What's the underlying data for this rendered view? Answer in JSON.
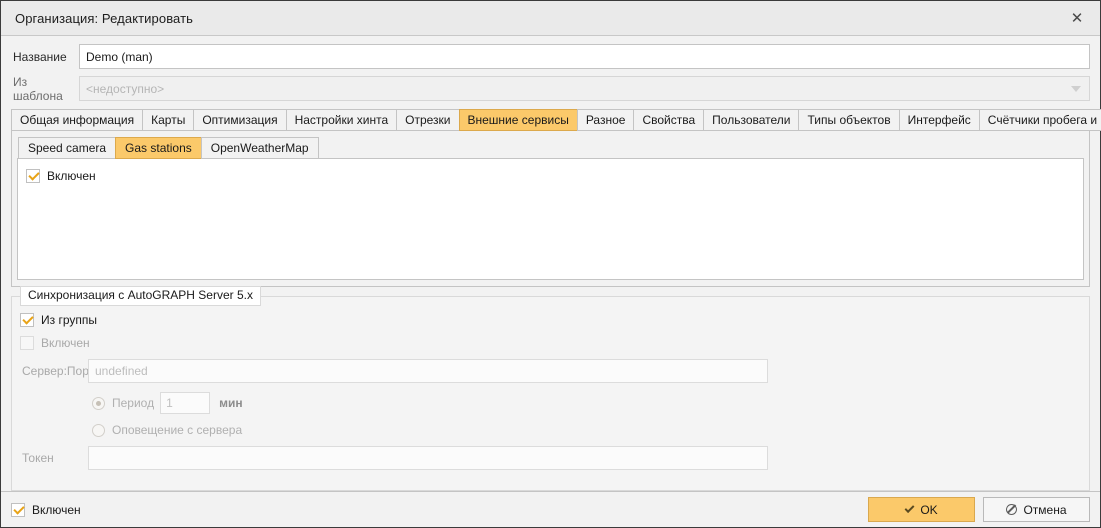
{
  "window": {
    "title": "Организация: Редактировать",
    "close_icon": "close-icon"
  },
  "form": {
    "name_label": "Название",
    "name_value": "Demo (man)",
    "template_label": "Из шаблона",
    "template_value": "<недоступно>",
    "dropdown_icon": "chevron-down-icon"
  },
  "tabs": [
    {
      "label": "Общая информация",
      "active": false
    },
    {
      "label": "Карты",
      "active": false
    },
    {
      "label": "Оптимизация",
      "active": false
    },
    {
      "label": "Настройки хинта",
      "active": false
    },
    {
      "label": "Отрезки",
      "active": false
    },
    {
      "label": "Внешние сервисы",
      "active": true
    },
    {
      "label": "Разное",
      "active": false
    },
    {
      "label": "Свойства",
      "active": false
    },
    {
      "label": "Пользователи",
      "active": false
    },
    {
      "label": "Типы объектов",
      "active": false
    },
    {
      "label": "Интерфейс",
      "active": false
    },
    {
      "label": "Счётчики пробега и моточасов",
      "active": false
    }
  ],
  "subtabs": [
    {
      "label": "Speed camera",
      "active": false
    },
    {
      "label": "Gas stations",
      "active": true
    },
    {
      "label": "OpenWeatherMap",
      "active": false
    }
  ],
  "service": {
    "enabled_label": "Включен",
    "enabled_checked": true
  },
  "sync": {
    "legend": "Синхронизация с AutoGRAPH Server 5.x",
    "from_group_label": "Из группы",
    "from_group_checked": true,
    "enabled_label": "Включен",
    "enabled_checked": false,
    "server_port_label": "Сервер:Порт",
    "server_port_value": "",
    "server_port_placeholder": "undefined",
    "period_label": "Период",
    "period_selected": true,
    "period_value": "1",
    "period_unit": "мин",
    "notify_label": "Оповещение с сервера",
    "notify_selected": false,
    "token_label": "Токен",
    "token_value": "",
    "token_placeholder": ""
  },
  "footer": {
    "enabled_label": "Включен",
    "enabled_checked": true,
    "ok_label": "OK",
    "ok_icon": "check-icon",
    "cancel_label": "Отмена",
    "cancel_icon": "ban-icon"
  },
  "colors": {
    "accent": "#fbc96a",
    "accent_border": "#dca94c",
    "check_mark": "#e8a317",
    "window_bg": "#f2f2f2",
    "titlebar_bg": "#eaeaea"
  }
}
